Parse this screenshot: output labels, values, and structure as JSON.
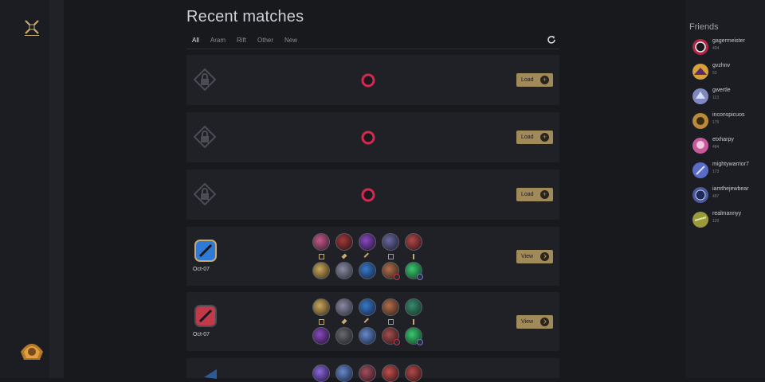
{
  "page": {
    "title": "Recent matches"
  },
  "tabs": [
    {
      "label": "All",
      "active": true
    },
    {
      "label": "Aram"
    },
    {
      "label": "Rift"
    },
    {
      "label": "Other"
    },
    {
      "label": "New"
    }
  ],
  "colors": {
    "gold": "#c8aa6e",
    "button": "#a08a5a",
    "card": "#1f2126",
    "blue_team": "#2e7ad6",
    "red_team": "#c2394a"
  },
  "icons": {
    "refresh": "refresh-icon",
    "lock": "lock-icon",
    "spinner": "loading-spinner-icon",
    "logo": "crossed-swords-icon",
    "emblem": "profile-emblem-icon"
  },
  "matches": {
    "locked": [
      {
        "button_label": "Load"
      },
      {
        "button_label": "Load"
      },
      {
        "button_label": "Load"
      }
    ],
    "played": [
      {
        "date": "Oct-07",
        "team_color": "blue",
        "button_label": "View"
      },
      {
        "date": "Oct-07",
        "team_color": "red",
        "button_label": "View"
      }
    ]
  },
  "friends": {
    "title": "Friends",
    "list": [
      {
        "name": "gagermeister",
        "number": "494",
        "avatar_color": "#b02545"
      },
      {
        "name": "gvzhnv",
        "number": "53",
        "avatar_color": "#d6a03a"
      },
      {
        "name": "gwertle",
        "number": "113",
        "avatar_color": "#8088c0"
      },
      {
        "name": "inconspicuos",
        "number": "175",
        "avatar_color": "#b88a3a"
      },
      {
        "name": "etxharpy",
        "number": "484",
        "avatar_color": "#c85a9c"
      },
      {
        "name": "mightywarrior7",
        "number": "173",
        "avatar_color": "#5a6cc8"
      },
      {
        "name": "iamthejewbear",
        "number": "497",
        "avatar_color": "#4a5a9c"
      },
      {
        "name": "realmannyy",
        "number": "120",
        "avatar_color": "#9a9a3a"
      }
    ]
  }
}
